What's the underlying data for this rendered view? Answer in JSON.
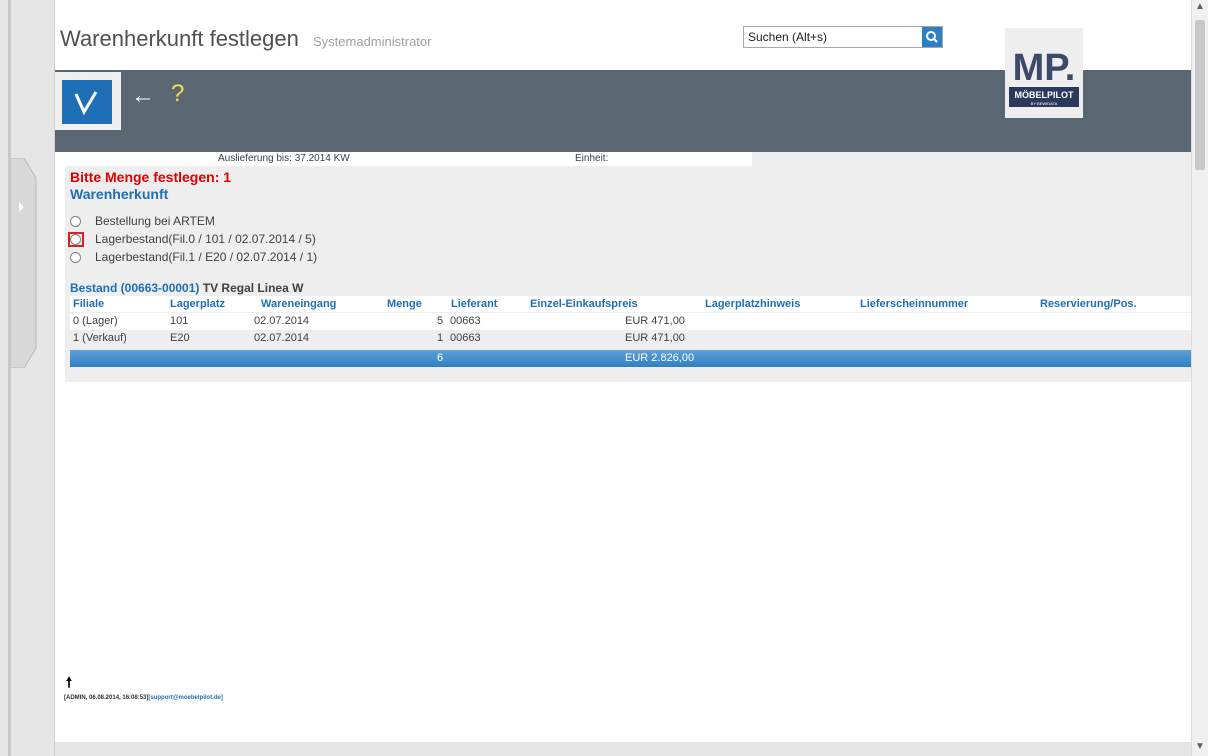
{
  "header": {
    "title": "Warenherkunft festlegen",
    "user": "Systemadministrator",
    "search_placeholder": "Suchen (Alt+s)",
    "search_value": "Suchen (Alt+s)"
  },
  "logo": {
    "line1": "MP.",
    "line2": "MÖBELPILOT",
    "line3": "BY BEWIDATA"
  },
  "toolbar": {
    "confirm_icon": "checkmark-icon",
    "back_label": "←",
    "back_icon": "back-arrow-icon",
    "help_label": "?",
    "help_icon": "help-icon"
  },
  "info": {
    "auslieferung": "Auslieferung bis:  37.2014 KW",
    "einheit": "Einheit:"
  },
  "prompt": "Bitte Menge festlegen: 1",
  "section_title": "Warenherkunft",
  "radio_options": [
    {
      "label": "Bestellung bei ARTEM",
      "selected": false
    },
    {
      "label": "Lagerbestand(Fil.0 / 101 / 02.07.2014 / 5)",
      "selected": false
    },
    {
      "label": "Lagerbestand(Fil.1 / E20 / 02.07.2014 / 1)",
      "selected": false
    }
  ],
  "bestand": {
    "prefix": "Bestand (00663-00001)",
    "product": " TV Regal Linea W"
  },
  "table": {
    "headers": [
      "Filiale",
      "Lagerplatz",
      "Wareneingang",
      "Menge",
      "Lieferant",
      "Einzel-Einkaufspreis",
      "Lagerplatzhinweis",
      "Lieferscheinnummer",
      "Reservierung/Pos."
    ],
    "rows": [
      {
        "filiale": "0 (Lager)",
        "lagerplatz": "101",
        "wareneingang": "02.07.2014",
        "menge": "5",
        "lieferant": "00663",
        "preis": "EUR 471,00"
      },
      {
        "filiale": "1 (Verkauf)",
        "lagerplatz": "E20",
        "wareneingang": "02.07.2014",
        "menge": "1",
        "lieferant": "00663",
        "preis": "EUR 471,00"
      }
    ],
    "sum": {
      "menge": "6",
      "preis": "EUR 2.826,00"
    }
  },
  "footer": {
    "arrow": "🠕",
    "meta": "[ADMIN, 06.08.2014, 16:08:53]",
    "support": "[support@moebelpilot.de]"
  },
  "colors": {
    "accent": "#1f6fb6",
    "toolbar": "#5a6773",
    "alert": "#e00000"
  }
}
